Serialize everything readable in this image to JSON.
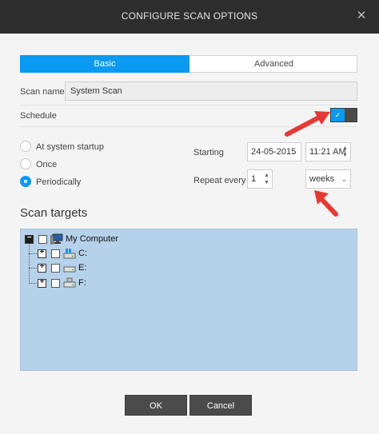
{
  "window": {
    "title": "CONFIGURE SCAN OPTIONS",
    "close_glyph": "✕"
  },
  "tabs": [
    {
      "label": "Basic",
      "selected": true
    },
    {
      "label": "Advanced",
      "selected": false
    }
  ],
  "scan_name": {
    "label": "Scan name:",
    "value": "System Scan"
  },
  "schedule": {
    "label": "Schedule",
    "enabled": true,
    "check_glyph": "✓"
  },
  "frequency": {
    "options": [
      {
        "label": "At system startup",
        "selected": false
      },
      {
        "label": "Once",
        "selected": false
      },
      {
        "label": "Periodically",
        "selected": true
      }
    ]
  },
  "starting": {
    "label": "Starting",
    "date": "24-05-2015",
    "time": "11:21 AM"
  },
  "repeat": {
    "label": "Repeat every",
    "value": "1",
    "unit": "weeks"
  },
  "scan_targets": {
    "title": "Scan targets",
    "items": [
      {
        "label": "My Computer",
        "expanded": true,
        "icon": "computer-icon"
      },
      {
        "label": "C:",
        "expanded": false,
        "icon": "system-drive-icon"
      },
      {
        "label": "E:",
        "expanded": false,
        "icon": "drive-icon"
      },
      {
        "label": "F:",
        "expanded": false,
        "icon": "usb-drive-icon"
      }
    ]
  },
  "buttons": {
    "ok": "OK",
    "cancel": "Cancel"
  },
  "colors": {
    "accent": "#0a9af0",
    "titlebar": "#2e2e2e",
    "tree_bg": "#b6d1ea",
    "annotation_arrow": "#e53935"
  }
}
